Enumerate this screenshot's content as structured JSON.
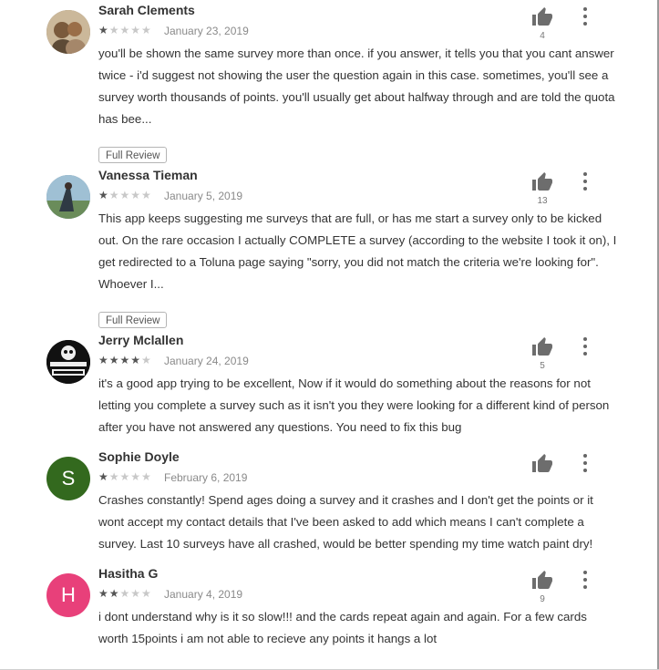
{
  "reviews": [
    {
      "name": "Sarah Clements",
      "rating": 1,
      "date": "January 23, 2019",
      "text": "you'll be shown the same survey more than once. if you answer, it tells you that you cant answer twice - i'd suggest not showing the user the question again in this case. sometimes, you'll see a survey worth thousands of points. you'll usually get about halfway through and are told the quota has bee...",
      "likes": "4",
      "full_review": "Full Review",
      "avatar": {
        "type": "photo",
        "color": "#8b7a63"
      }
    },
    {
      "name": "Vanessa Tieman",
      "rating": 1,
      "date": "January 5, 2019",
      "text": "This app keeps suggesting me surveys that are full, or has me start a survey only to be kicked out. On the rare occasion I actually COMPLETE a survey (according to the website I took it on), I get redirected to a Toluna page saying \"sorry, you did not match the criteria we're looking for\". Whoever I...",
      "likes": "13",
      "full_review": "Full Review",
      "avatar": {
        "type": "photo",
        "color": "#6f8da0"
      }
    },
    {
      "name": "Jerry Mclallen",
      "rating": 4,
      "date": "January 24, 2019",
      "text": "it's a good app trying to be excellent, Now if it would do something about the reasons for not letting you complete a survey such as it isn't you they were looking for a different kind of person after you have not answered any questions. You need to fix this bug",
      "likes": "5",
      "avatar": {
        "type": "logo",
        "color": "#111111",
        "logo_text": "NEVER TOO OLD TO ROCK"
      }
    },
    {
      "name": "Sophie Doyle",
      "rating": 1,
      "date": "February 6, 2019",
      "text": "Crashes constantly! Spend ages doing a survey and it crashes and I don't get the points or it wont accept my contact details that I've been asked to add which means I can't complete a survey. Last 10 surveys have all crashed, would be better spending my time watch paint dry!",
      "likes": "",
      "avatar": {
        "type": "letter",
        "letter": "S",
        "color": "#33691e"
      }
    },
    {
      "name": "Hasitha G",
      "rating": 2,
      "date": "January 4, 2019",
      "text": "i dont understand why is it so slow!!! and the cards repeat again and again. For a few cards worth 15points i am not able to recieve any points it hangs a lot",
      "likes": "9",
      "avatar": {
        "type": "letter",
        "letter": "H",
        "color": "#e8407a"
      }
    }
  ],
  "icons": {
    "like": "thumb-up-icon",
    "more": "more-vert-icon",
    "star": "star-icon"
  }
}
